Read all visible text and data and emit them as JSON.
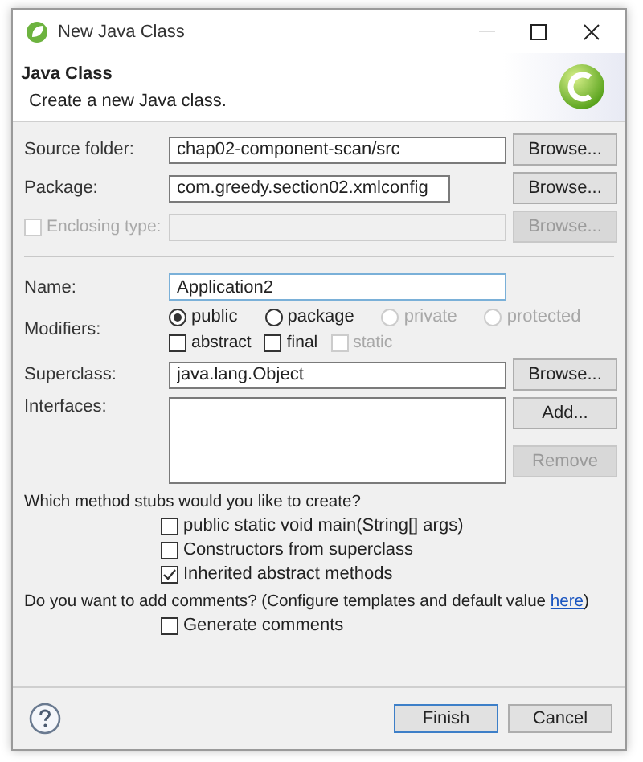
{
  "window": {
    "title": "New Java Class"
  },
  "header": {
    "title": "Java Class",
    "description": "Create a new Java class."
  },
  "location": [
    {
      "kind": "text",
      "label": "Source folder:",
      "value": "chap02-component-scan/src",
      "button": {
        "label": "Browse...",
        "disabled": false
      }
    },
    {
      "kind": "short",
      "label": "Package:",
      "value": "com.greedy.section02.xmlconfig",
      "button": {
        "label": "Browse...",
        "disabled": false
      }
    },
    {
      "kind": "check",
      "label": "Enclosing type:",
      "checked": false,
      "disabled": true,
      "button": {
        "label": "Browse...",
        "disabled": true
      }
    }
  ],
  "name": {
    "label": "Name:",
    "value": "Application2"
  },
  "modifiers": {
    "label": "Modifiers:",
    "radios": [
      {
        "label": "public",
        "selected": true,
        "disabled": false
      },
      {
        "label": "package",
        "selected": false,
        "disabled": false
      },
      {
        "label": "private",
        "selected": false,
        "disabled": true
      },
      {
        "label": "protected",
        "selected": false,
        "disabled": true
      }
    ],
    "checks": [
      {
        "label": "abstract",
        "checked": false,
        "disabled": false
      },
      {
        "label": "final",
        "checked": false,
        "disabled": false
      },
      {
        "label": "static",
        "checked": false,
        "disabled": true
      }
    ]
  },
  "superclass": {
    "label": "Superclass:",
    "value": "java.lang.Object",
    "button": {
      "label": "Browse...",
      "disabled": false
    }
  },
  "interfaces": {
    "label": "Interfaces:",
    "buttons": [
      {
        "label": "Add...",
        "disabled": false
      },
      {
        "label": "Remove",
        "disabled": true
      }
    ]
  },
  "stubs": {
    "question": "Which method stubs would you like to create?",
    "options": [
      {
        "label": "public static void main(String[] args)",
        "checked": false
      },
      {
        "label": "Constructors from superclass",
        "checked": false
      },
      {
        "label": "Inherited abstract methods",
        "checked": true
      }
    ]
  },
  "comments": {
    "question": "Do you want to add comments? (Configure templates and default value ",
    "link": "here",
    "suffix": ")",
    "options": [
      {
        "label": "Generate comments",
        "checked": false
      }
    ]
  },
  "footer": {
    "buttons": [
      {
        "label": "Finish",
        "default": true
      },
      {
        "label": "Cancel",
        "default": false
      }
    ]
  }
}
